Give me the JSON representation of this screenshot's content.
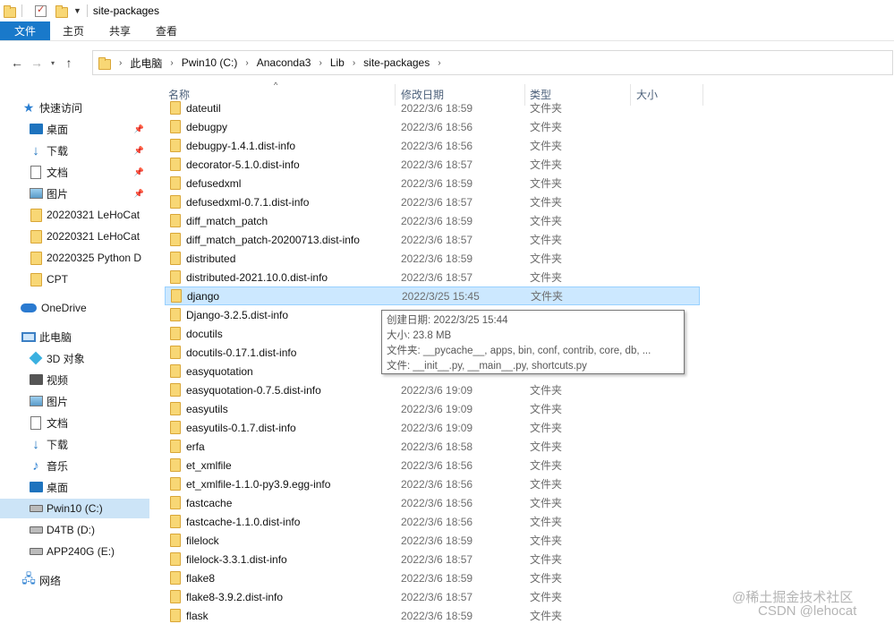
{
  "window": {
    "title": "site-packages"
  },
  "ribbon": {
    "tabs": [
      "文件",
      "主页",
      "共享",
      "查看"
    ]
  },
  "address": {
    "back_icon": "arrow-left-icon",
    "crumbs": [
      "此电脑",
      "Pwin10 (C:)",
      "Anaconda3",
      "Lib",
      "site-packages"
    ]
  },
  "sidebar": {
    "items": [
      {
        "label": "快速访问",
        "icon": "star-icon"
      },
      {
        "label": "桌面",
        "icon": "desktop-icon",
        "pinned": true
      },
      {
        "label": "下载",
        "icon": "download-icon",
        "pinned": true
      },
      {
        "label": "文档",
        "icon": "document-icon",
        "pinned": true
      },
      {
        "label": "图片",
        "icon": "picture-icon",
        "pinned": true
      },
      {
        "label": "20220321 LeHoCat",
        "icon": "folder-icon"
      },
      {
        "label": "20220321 LeHoCat",
        "icon": "folder-icon"
      },
      {
        "label": "20220325 Python D",
        "icon": "folder-icon"
      },
      {
        "label": "CPT",
        "icon": "folder-icon"
      },
      {
        "label": "OneDrive",
        "icon": "cloud-icon"
      },
      {
        "label": "此电脑",
        "icon": "pc-icon"
      },
      {
        "label": "3D 对象",
        "icon": "cube-icon"
      },
      {
        "label": "视频",
        "icon": "video-icon"
      },
      {
        "label": "图片",
        "icon": "picture-icon"
      },
      {
        "label": "文档",
        "icon": "document-icon"
      },
      {
        "label": "下载",
        "icon": "download-icon"
      },
      {
        "label": "音乐",
        "icon": "music-icon"
      },
      {
        "label": "桌面",
        "icon": "desktop-icon"
      },
      {
        "label": "Pwin10 (C:)",
        "icon": "drive-icon",
        "selected": true
      },
      {
        "label": "D4TB (D:)",
        "icon": "drive-icon"
      },
      {
        "label": "APP240G (E:)",
        "icon": "drive-icon"
      },
      {
        "label": "网络",
        "icon": "network-icon"
      }
    ]
  },
  "columns": {
    "name": "名称",
    "date": "修改日期",
    "type": "类型",
    "size": "大小"
  },
  "files": [
    {
      "name": "dateutil",
      "date": "2022/3/6 18:59",
      "type": "文件夹"
    },
    {
      "name": "debugpy",
      "date": "2022/3/6 18:56",
      "type": "文件夹"
    },
    {
      "name": "debugpy-1.4.1.dist-info",
      "date": "2022/3/6 18:56",
      "type": "文件夹"
    },
    {
      "name": "decorator-5.1.0.dist-info",
      "date": "2022/3/6 18:57",
      "type": "文件夹"
    },
    {
      "name": "defusedxml",
      "date": "2022/3/6 18:59",
      "type": "文件夹"
    },
    {
      "name": "defusedxml-0.7.1.dist-info",
      "date": "2022/3/6 18:57",
      "type": "文件夹"
    },
    {
      "name": "diff_match_patch",
      "date": "2022/3/6 18:59",
      "type": "文件夹"
    },
    {
      "name": "diff_match_patch-20200713.dist-info",
      "date": "2022/3/6 18:57",
      "type": "文件夹"
    },
    {
      "name": "distributed",
      "date": "2022/3/6 18:59",
      "type": "文件夹"
    },
    {
      "name": "distributed-2021.10.0.dist-info",
      "date": "2022/3/6 18:57",
      "type": "文件夹"
    },
    {
      "name": "django",
      "date": "2022/3/25 15:45",
      "type": "文件夹",
      "selected": true
    },
    {
      "name": "Django-3.2.5.dist-info",
      "date": "",
      "type": ""
    },
    {
      "name": "docutils",
      "date": "",
      "type": ""
    },
    {
      "name": "docutils-0.17.1.dist-info",
      "date": "",
      "type": ""
    },
    {
      "name": "easyquotation",
      "date": "",
      "type": ""
    },
    {
      "name": "easyquotation-0.7.5.dist-info",
      "date": "2022/3/6 19:09",
      "type": "文件夹"
    },
    {
      "name": "easyutils",
      "date": "2022/3/6 19:09",
      "type": "文件夹"
    },
    {
      "name": "easyutils-0.1.7.dist-info",
      "date": "2022/3/6 19:09",
      "type": "文件夹"
    },
    {
      "name": "erfa",
      "date": "2022/3/6 18:58",
      "type": "文件夹"
    },
    {
      "name": "et_xmlfile",
      "date": "2022/3/6 18:56",
      "type": "文件夹"
    },
    {
      "name": "et_xmlfile-1.1.0-py3.9.egg-info",
      "date": "2022/3/6 18:56",
      "type": "文件夹"
    },
    {
      "name": "fastcache",
      "date": "2022/3/6 18:56",
      "type": "文件夹"
    },
    {
      "name": "fastcache-1.1.0.dist-info",
      "date": "2022/3/6 18:56",
      "type": "文件夹"
    },
    {
      "name": "filelock",
      "date": "2022/3/6 18:59",
      "type": "文件夹"
    },
    {
      "name": "filelock-3.3.1.dist-info",
      "date": "2022/3/6 18:57",
      "type": "文件夹"
    },
    {
      "name": "flake8",
      "date": "2022/3/6 18:59",
      "type": "文件夹"
    },
    {
      "name": "flake8-3.9.2.dist-info",
      "date": "2022/3/6 18:57",
      "type": "文件夹"
    },
    {
      "name": "flask",
      "date": "2022/3/6 18:59",
      "type": "文件夹"
    }
  ],
  "tooltip": {
    "created": "创建日期: 2022/3/25 15:44",
    "size": "大小: 23.8 MB",
    "folders": "文件夹: __pycache__, apps, bin, conf, contrib, core, db, ...",
    "files": "文件: __init__.py, __main__.py, shortcuts.py"
  },
  "watermark": {
    "line1": "@稀土掘金技术社区",
    "line2": "CSDN @lehocat"
  },
  "colors": {
    "file_tab": "#1979ca",
    "selection": "#cce8ff",
    "selection_border": "#99d1ff",
    "nav_selected": "#cce4f7",
    "folder": "#f8d775"
  }
}
